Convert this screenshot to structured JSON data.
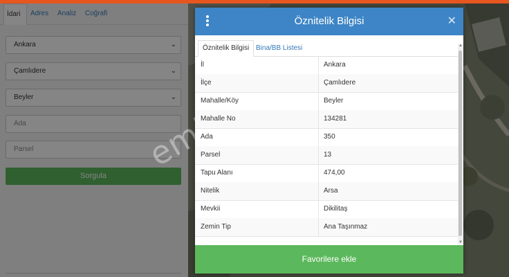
{
  "left_panel": {
    "tabs": [
      "İdari",
      "Adres",
      "Analiz",
      "Coğrafi"
    ],
    "fields": {
      "il": "Ankara",
      "ilce": "Çamlıdere",
      "mahalle": "Beyler",
      "ada_placeholder": "Ada",
      "parsel_placeholder": "Parsel"
    },
    "query_button": "Sorgula"
  },
  "watermark": "emlakjet.com",
  "modal": {
    "title": "Öznitelik Bilgisi",
    "tabs": [
      "Öznitelik Bilgisi",
      "Bina/BB Listesi"
    ],
    "rows": [
      {
        "key": "İl",
        "value": "Ankara"
      },
      {
        "key": "İlçe",
        "value": "Çamlıdere"
      },
      {
        "key": "Mahalle/Köy",
        "value": "Beyler"
      },
      {
        "key": "Mahalle No",
        "value": "134281"
      },
      {
        "key": "Ada",
        "value": "350"
      },
      {
        "key": "Parsel",
        "value": "13"
      },
      {
        "key": "Tapu Alanı",
        "value": "474,00"
      },
      {
        "key": "Nitelik",
        "value": "Arsa"
      },
      {
        "key": "Mevkii",
        "value": "Dikilitaş"
      },
      {
        "key": "Zemin Tip",
        "value": "Ana Taşınmaz"
      }
    ],
    "favorite_button": "Favorilere ekle"
  },
  "icons": {
    "menu": "kebab-menu-icon",
    "close": "close-icon",
    "dropdown": "chevron-down-icon"
  },
  "colors": {
    "header_blue": "#3d85c6",
    "button_green": "#5cb85c",
    "top_orange": "#e8561f"
  }
}
